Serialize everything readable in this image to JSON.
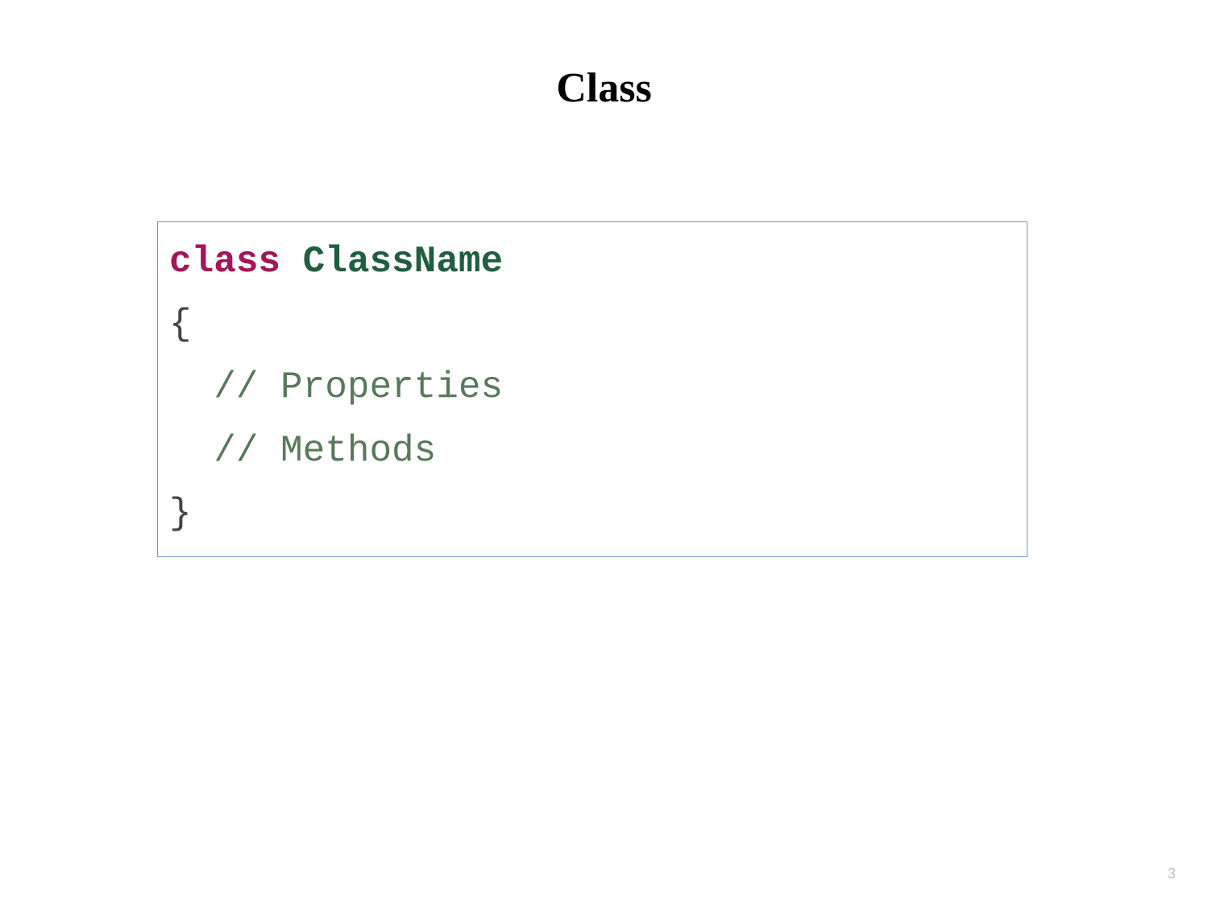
{
  "title": "Class",
  "code": {
    "keyword": "class",
    "space": " ",
    "classname": "ClassName",
    "open_brace": "{",
    "comment_properties": "  // Properties",
    "blank": "",
    "comment_methods": "  // Methods",
    "close_brace": "}"
  },
  "page_number": "3"
}
